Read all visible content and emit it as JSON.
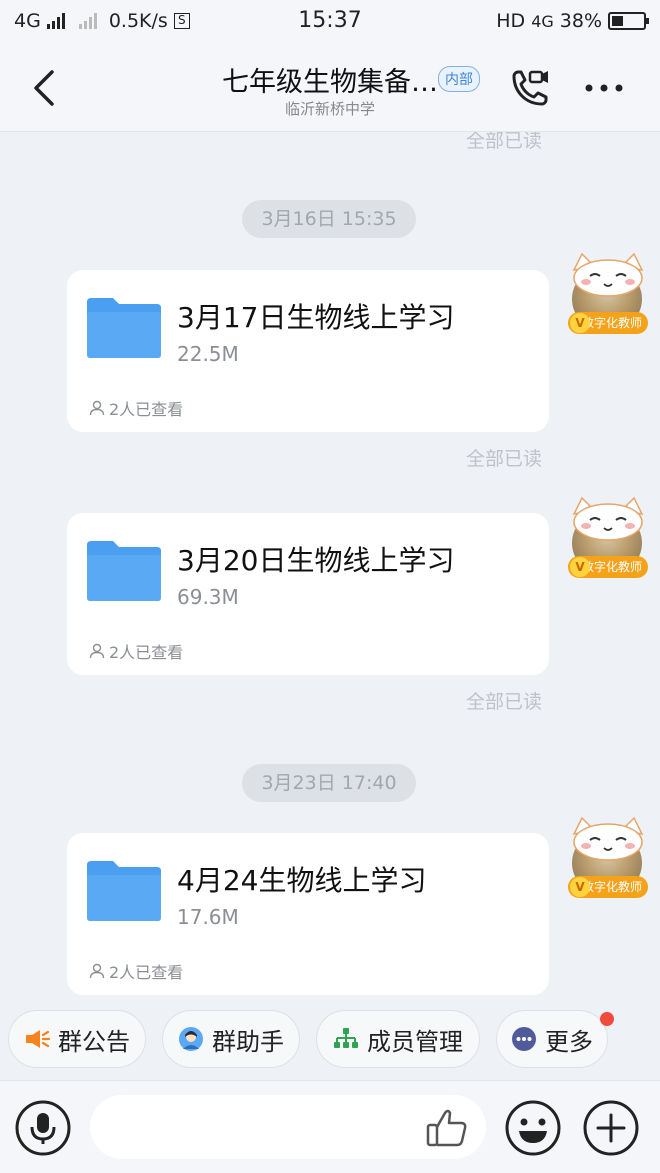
{
  "status_bar": {
    "network": "4G",
    "speed": "0.5K/s",
    "sim_box": "S",
    "time": "15:37",
    "hd": "HD",
    "network2": "4G",
    "battery": "38%"
  },
  "header": {
    "back_icon": "chevron-left-icon",
    "title": "七年级生物集备…",
    "badge": "内部",
    "subtitle": "临沂新桥中学",
    "call_icon": "phone-video-icon",
    "more_icon": "more-dots-icon"
  },
  "chat": {
    "top_read_status": "全部已读",
    "messages": [
      {
        "timestamp": "3月16日 15:35",
        "file_name": "3月17日生物线上学习",
        "file_size": "22.5M",
        "viewers": "2人已查看",
        "read_status": "全部已读"
      },
      {
        "file_name": "3月20日生物线上学习",
        "file_size": "69.3M",
        "viewers": "2人已查看",
        "read_status": "全部已读"
      },
      {
        "timestamp": "3月23日 17:40",
        "file_name": "4月24生物线上学习",
        "file_size": "17.6M",
        "viewers": "2人已查看"
      }
    ],
    "avatar_tag": "数字化教师",
    "avatar_v": "V"
  },
  "quick_actions": [
    {
      "label": "群公告",
      "icon": "megaphone-icon"
    },
    {
      "label": "群助手",
      "icon": "assistant-icon"
    },
    {
      "label": "成员管理",
      "icon": "org-tree-icon"
    },
    {
      "label": "更多",
      "icon": "more-circle-icon"
    }
  ],
  "input_bar": {
    "mic_icon": "microphone-icon",
    "like_icon": "thumbs-up-icon",
    "emoji_icon": "smile-icon",
    "add_icon": "plus-circle-icon"
  },
  "colors": {
    "accent_blue": "#4a90e2",
    "folder_blue": "#4a9ff0",
    "badge_blue": "#3d86d9",
    "notice_orange": "#f5841f",
    "member_green": "#2ea44f",
    "red_dot": "#f04b3c",
    "tag_orange": "#f5a21b"
  }
}
